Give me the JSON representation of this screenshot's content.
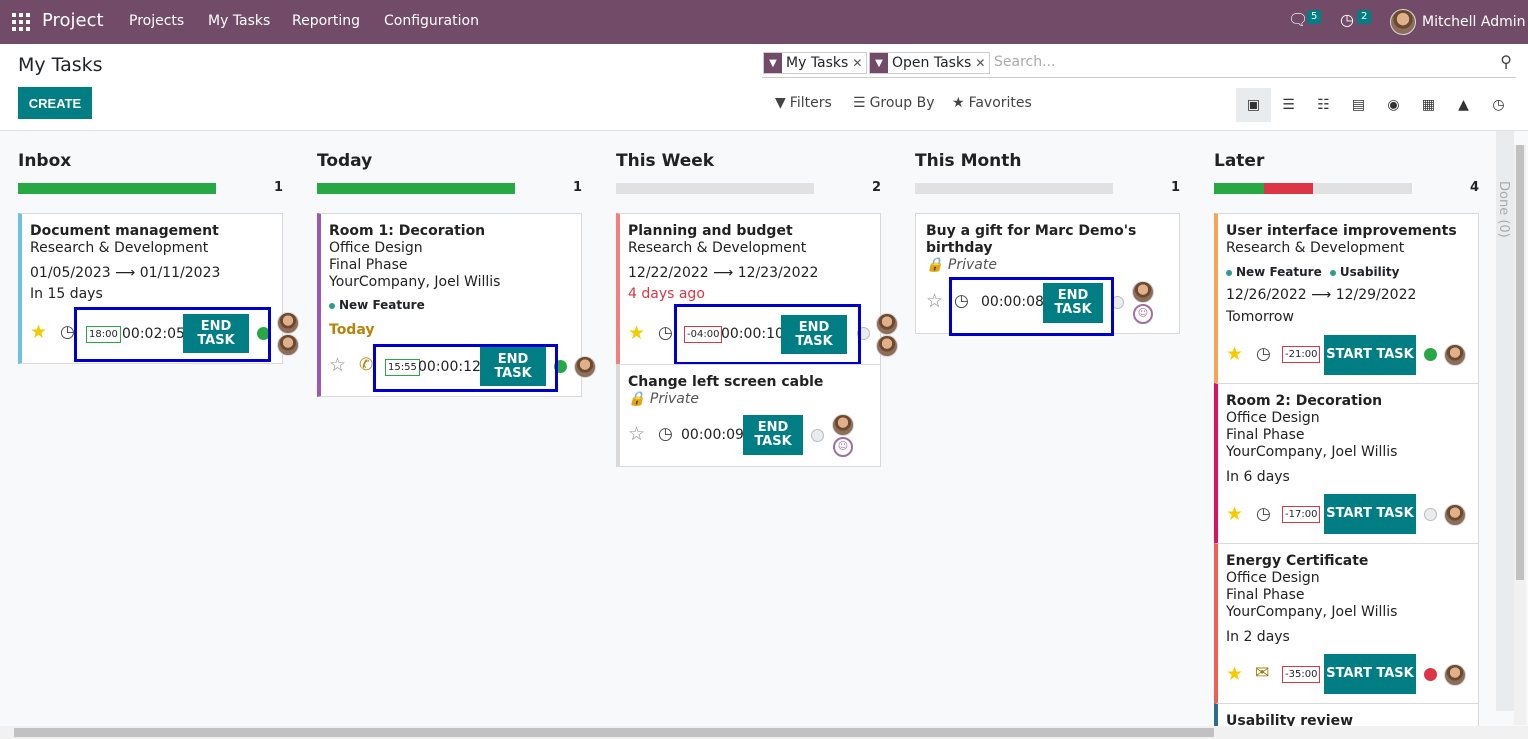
{
  "topbar": {
    "brand": "Project",
    "menu": [
      "Projects",
      "My Tasks",
      "Reporting",
      "Configuration"
    ],
    "chat_count": "5",
    "activity_count": "2",
    "user": "Mitchell Admin"
  },
  "control": {
    "title": "My Tasks",
    "create": "CREATE",
    "facets": [
      "My Tasks",
      "Open Tasks"
    ],
    "search_placeholder": "Search...",
    "filters": "Filters",
    "group_by": "Group By",
    "favorites": "Favorites"
  },
  "done_column": "Done (0)",
  "columns": [
    {
      "name": "Inbox",
      "count": "1",
      "progress": [
        {
          "color": "#28a745",
          "pct": 100
        }
      ]
    },
    {
      "name": "Today",
      "count": "1",
      "progress": [
        {
          "color": "#28a745",
          "pct": 100
        }
      ]
    },
    {
      "name": "This Week",
      "count": "2",
      "progress": []
    },
    {
      "name": "This Month",
      "count": "1",
      "progress": []
    },
    {
      "name": "Later",
      "count": "4",
      "progress": [
        {
          "color": "#28a745",
          "pct": 25
        },
        {
          "color": "#dc3545",
          "pct": 25
        }
      ]
    }
  ],
  "cards": {
    "doc": {
      "title": "Document management",
      "project": "Research & Development",
      "dates": [
        "01/05/2023",
        "01/11/2023"
      ],
      "deadline": "In 15 days",
      "time_box": "18:00",
      "timer": "00:02:05",
      "button": "END TASK"
    },
    "room1": {
      "title": "Room 1: Decoration",
      "project": "Office Design",
      "stage": "Final Phase",
      "partner": "YourCompany, Joel Willis",
      "tag": "New Feature",
      "deadline": "Today",
      "time_box": "15:55",
      "timer": "00:00:12",
      "button": "END TASK"
    },
    "plan": {
      "title": "Planning and budget",
      "project": "Research & Development",
      "dates": [
        "12/22/2022",
        "12/23/2022"
      ],
      "deadline": "4 days ago",
      "time_box": "-04:00",
      "timer": "00:00:10",
      "button": "END TASK"
    },
    "cable": {
      "title": "Change left screen cable",
      "private": "Private",
      "timer": "00:00:09",
      "button": "END TASK"
    },
    "gift": {
      "title_1": "Buy a gift for Marc Demo's",
      "title_2": "birthday",
      "private": "Private",
      "timer": "00:00:08",
      "button": "END TASK"
    },
    "ui": {
      "title": "User interface improvements",
      "project": "Research & Development",
      "tags": [
        "New Feature",
        "Usability"
      ],
      "dates": [
        "12/26/2022",
        "12/29/2022"
      ],
      "deadline": "Tomorrow",
      "time_box": "-21:00",
      "button": "START TASK"
    },
    "room2": {
      "title": "Room 2: Decoration",
      "project": "Office Design",
      "stage": "Final Phase",
      "partner": "YourCompany, Joel Willis",
      "deadline": "In 6 days",
      "time_box": "-17:00",
      "button": "START TASK"
    },
    "energy": {
      "title": "Energy Certificate",
      "project": "Office Design",
      "stage": "Final Phase",
      "partner": "YourCompany, Joel Willis",
      "deadline": "In 2 days",
      "time_box": "-35:00",
      "button": "START TASK"
    },
    "usability": {
      "title": "Usability review"
    }
  }
}
